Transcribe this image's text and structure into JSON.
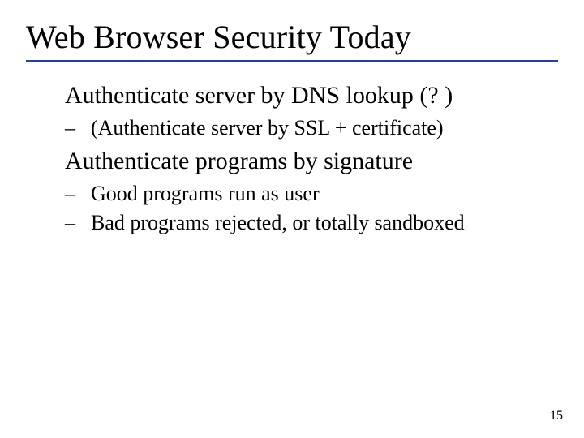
{
  "title": "Web Browser Security Today",
  "body": {
    "item1": {
      "text": "Authenticate server by DNS lookup (? )",
      "sub1": "(Authenticate server by SSL + certificate)"
    },
    "item2": {
      "text": "Authenticate programs by signature",
      "sub1": "Good programs run as user",
      "sub2": "Bad programs rejected, or totally sandboxed"
    }
  },
  "dash": "– ",
  "pagenum": "15"
}
